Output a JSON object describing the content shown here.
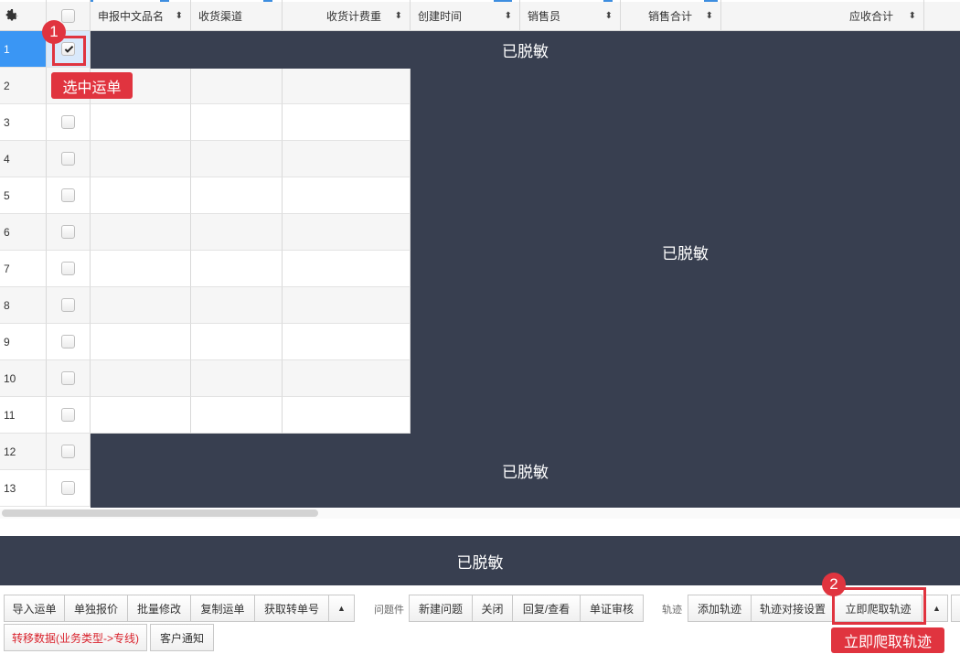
{
  "header": {
    "columns": [
      "申报中文品名",
      "收货渠道",
      "收货计费重",
      "创建时间",
      "销售员",
      "销售合计",
      "应收合计"
    ],
    "sort_icon": "⬍"
  },
  "rows": [
    "1",
    "2",
    "3",
    "4",
    "5",
    "6",
    "7",
    "8",
    "9",
    "10",
    "11",
    "12",
    "13"
  ],
  "masked_text": "已脱敏",
  "annotations": {
    "step1_number": "1",
    "step1_label": "选中运单",
    "step2_number": "2",
    "step2_label": "立即爬取轨迹"
  },
  "toolbar": {
    "group1_buttons": [
      "导入运单",
      "单独报价",
      "批量修改",
      "复制运单",
      "获取转单号"
    ],
    "arrow_up": "▲",
    "problem_label": "问题件",
    "problem_buttons": [
      "新建问题",
      "关闭",
      "回复/查看",
      "单证审核"
    ],
    "track_label": "轨迹",
    "track_buttons": [
      "添加轨迹",
      "轨迹对接设置",
      "立即爬取轨迹"
    ],
    "row2_buttons": [
      "转移数据(业务类型->专线)",
      "客户通知"
    ]
  },
  "colors": {
    "accent": "#3d8ee0",
    "mask": "#383f50",
    "highlight": "#e0343f",
    "selected_row": "#3a96f4"
  }
}
